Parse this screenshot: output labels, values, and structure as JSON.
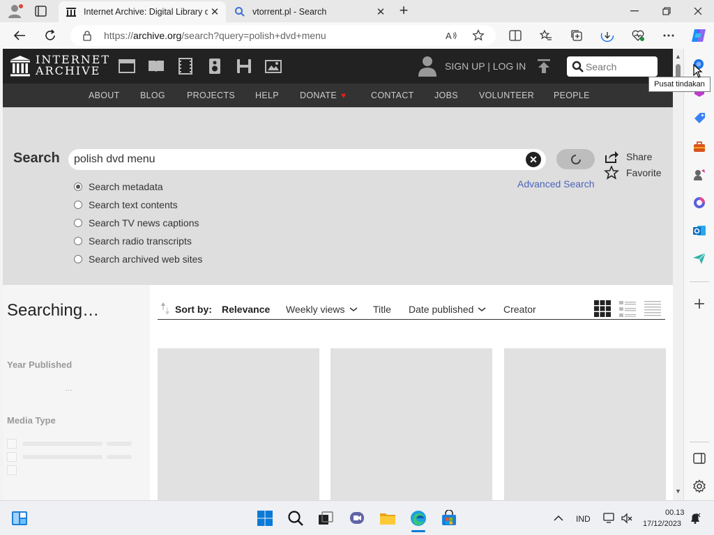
{
  "browser": {
    "tabs": [
      {
        "title": "Internet Archive: Digital Library o",
        "active": true
      },
      {
        "title": "vtorrent.pl - Search",
        "active": false
      }
    ],
    "url_prefix": "https://",
    "url_domain": "archive.org",
    "url_path": "/search?query=polish+dvd+menu",
    "tooltip": "Pusat tindakan"
  },
  "ia": {
    "logo_line1": "INTERNET",
    "logo_line2": "ARCHIVE",
    "signup": "SIGN UP | LOG IN",
    "nav_search_placeholder": "Search",
    "subnav": [
      "ABOUT",
      "BLOG",
      "PROJECTS",
      "HELP",
      "DONATE",
      "CONTACT",
      "JOBS",
      "VOLUNTEER",
      "PEOPLE"
    ],
    "search_label": "Search",
    "query": "polish dvd menu",
    "share": "Share",
    "favorite": "Favorite",
    "advanced": "Advanced Search",
    "radios": [
      {
        "label": "Search metadata",
        "checked": true
      },
      {
        "label": "Search text contents",
        "checked": false
      },
      {
        "label": "Search TV news captions",
        "checked": false
      },
      {
        "label": "Search radio transcripts",
        "checked": false
      },
      {
        "label": "Search archived web sites",
        "checked": false
      }
    ],
    "searching": "Searching…",
    "facet_year": "Year Published",
    "facet_dots": "…",
    "facet_media": "Media Type",
    "sort_label": "Sort by:",
    "sort_options": [
      "Relevance",
      "Weekly views",
      "Title",
      "Date published",
      "Creator"
    ]
  },
  "taskbar": {
    "lang": "IND",
    "time": "00.13",
    "date": "17/12/2023"
  },
  "colors": {
    "ia_header": "#222222",
    "ia_subnav": "#333333",
    "search_panel": "#dedede",
    "link": "#4b64b8",
    "donate_heart": "#e02020"
  }
}
